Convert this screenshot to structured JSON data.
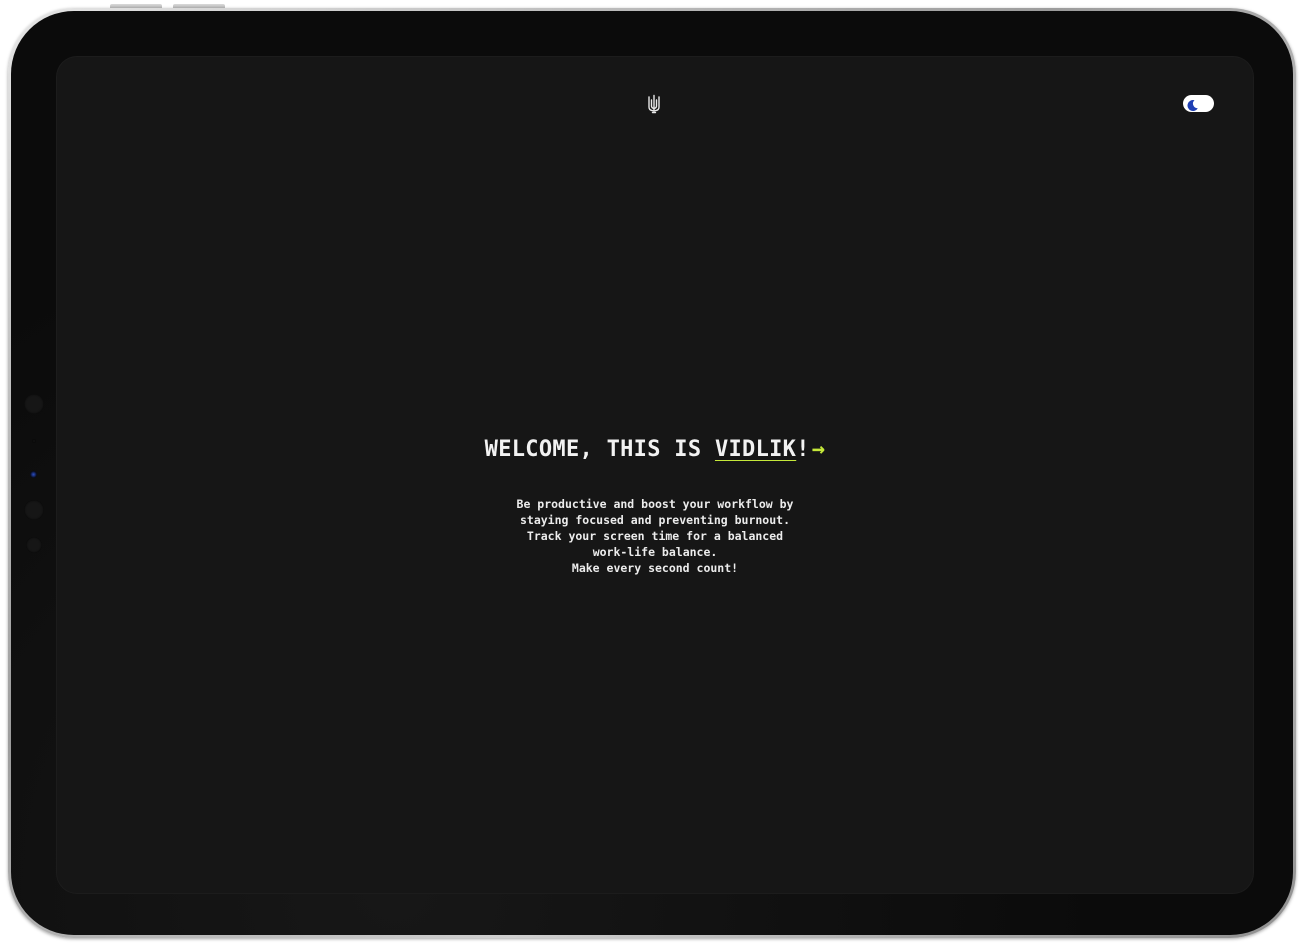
{
  "app": {
    "logo_icon": "trident-icon",
    "theme_toggle": {
      "icon": "moon-icon",
      "mode": "dark"
    }
  },
  "hero": {
    "title_prefix": "WELCOME, THIS IS ",
    "brand": "VIDLIK",
    "exclamation": "!",
    "arrow": "→",
    "tagline": [
      "Be productive and boost your workflow by",
      "staying focused and preventing burnout.",
      "Track your screen time for a balanced",
      "work-life balance.",
      "Make every second count!"
    ]
  },
  "colors": {
    "background": "#161616",
    "text": "#f2f2f2",
    "accent": "#c5e83a",
    "toggle_bg": "#ffffff",
    "moon": "#1f3fb3"
  }
}
